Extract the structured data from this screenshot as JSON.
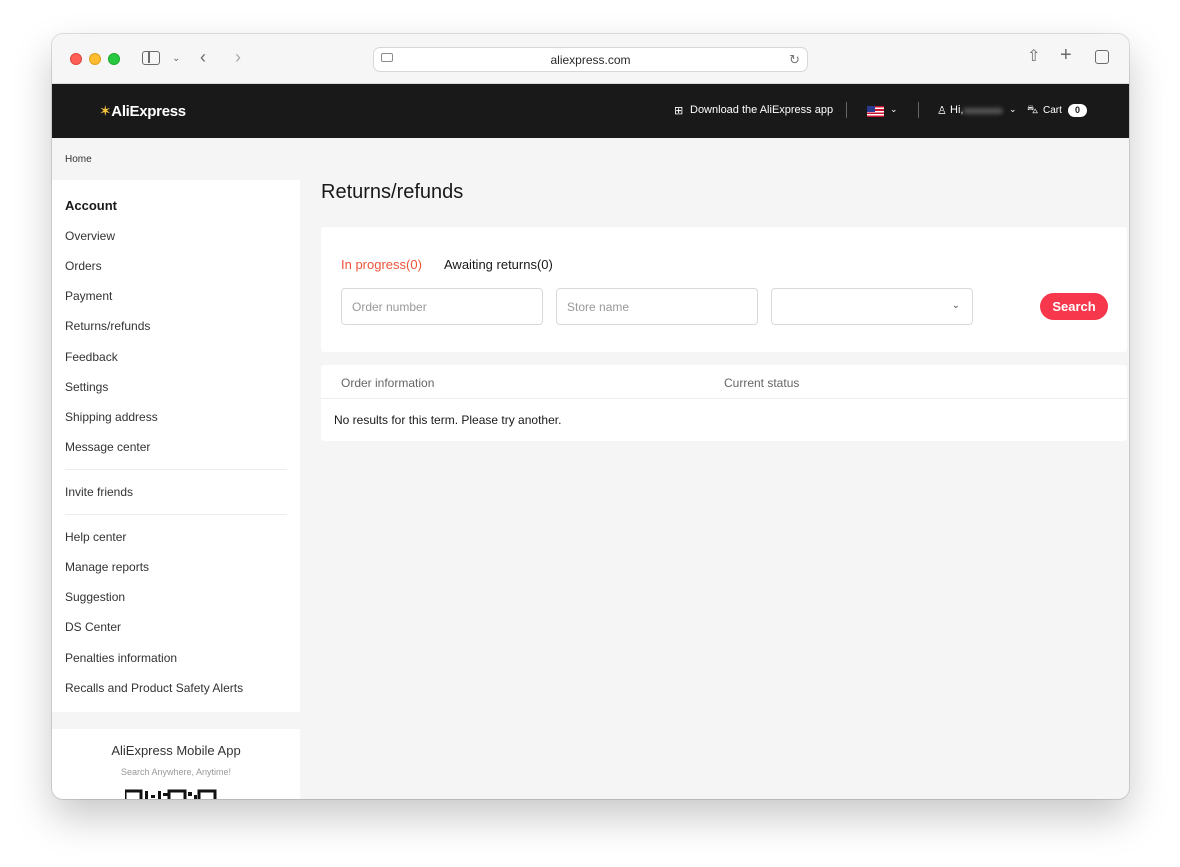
{
  "browser": {
    "url": "aliexpress.com"
  },
  "header": {
    "logo": "AliExpress",
    "download_app": "Download the AliExpress app",
    "greeting": "Hi,",
    "cart_label": "Cart",
    "cart_count": "0"
  },
  "breadcrumb": "Home",
  "sidebar": {
    "title": "Account",
    "group1": [
      "Overview",
      "Orders",
      "Payment",
      "Returns/refunds",
      "Feedback",
      "Settings",
      "Shipping address",
      "Message center"
    ],
    "group2": [
      "Invite friends"
    ],
    "group3": [
      "Help center",
      "Manage reports",
      "Suggestion",
      "DS Center",
      "Penalties information",
      "Recalls and Product Safety Alerts"
    ]
  },
  "app_promo": {
    "title": "AliExpress Mobile App",
    "subtitle": "Search Anywhere, Anytime!"
  },
  "main": {
    "title": "Returns/refunds",
    "tabs": [
      {
        "label": "In progress(0)",
        "active": true
      },
      {
        "label": "Awaiting returns(0)",
        "active": false
      }
    ],
    "filters": {
      "order_number_placeholder": "Order number",
      "store_name_placeholder": "Store name",
      "status_select_value": ""
    },
    "search_label": "Search",
    "table": {
      "columns": [
        "Order information",
        "Current status"
      ],
      "empty_message": "No results for this term. Please try another."
    }
  },
  "colors": {
    "header_bg": "#191919",
    "accent": "#ef5438",
    "search_button": "#f7374b"
  }
}
